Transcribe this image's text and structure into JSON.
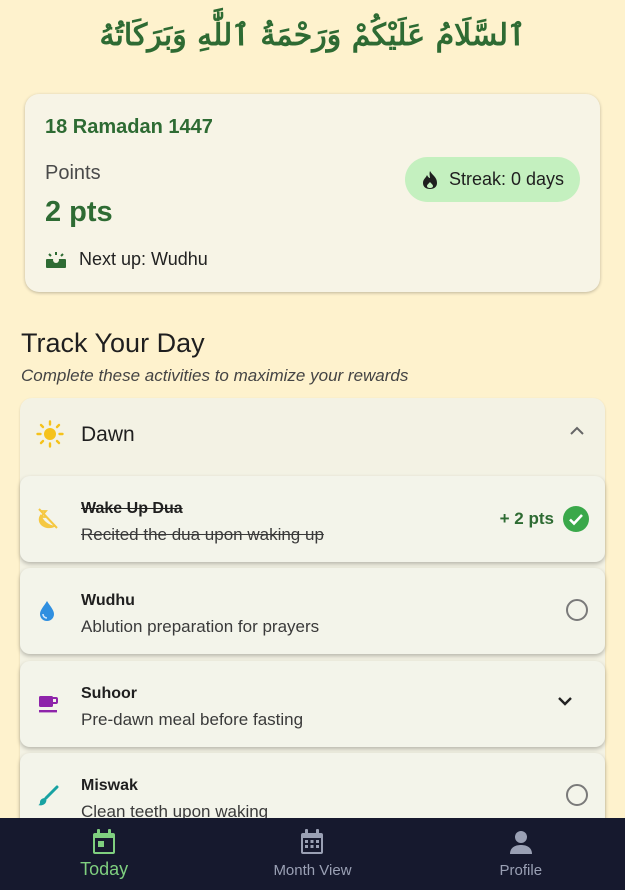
{
  "greeting": "ٱلسَّلَامُ عَلَيْكُمْ وَرَحْمَةُ ٱللَّٰهِ وَبَرَكَاتُهُ",
  "summary": {
    "hijri_date": "18 Ramadan 1447",
    "points_label": "Points",
    "points_value": "2 pts",
    "next_up": "Next up: Wudhu",
    "streak": "Streak: 0 days"
  },
  "section": {
    "title": "Track Your Day",
    "subtitle": "Complete these activities to maximize your rewards"
  },
  "dawn": {
    "title": "Dawn",
    "activities": [
      {
        "name": "Wake Up Dua",
        "desc": "Recited the dua upon waking up",
        "points": "+ 2 pts",
        "state": "completed",
        "icon": "sleep-moon-icon",
        "icon_color": "#f5c842"
      },
      {
        "name": "Wudhu",
        "desc": "Ablution preparation for prayers",
        "state": "unchecked",
        "icon": "water-drop-icon",
        "icon_color": "#2f8fe0"
      },
      {
        "name": "Suhoor",
        "desc": "Pre-dawn meal before fasting",
        "state": "expandable",
        "icon": "coffee-cup-icon",
        "icon_color": "#8e24aa"
      },
      {
        "name": "Miswak",
        "desc": "Clean teeth upon waking",
        "state": "unchecked",
        "icon": "brush-icon",
        "icon_color": "#17a2a2"
      }
    ]
  },
  "nav": {
    "items": [
      {
        "label": "Today",
        "icon": "calendar-today-icon",
        "active": true
      },
      {
        "label": "Month View",
        "icon": "calendar-month-icon",
        "active": false
      },
      {
        "label": "Profile",
        "icon": "person-icon",
        "active": false
      }
    ]
  },
  "colors": {
    "background": "#fef2cd",
    "primary_green": "#2e6b33",
    "streak_bg": "#c4f0bf",
    "nav_bg": "#16192e",
    "nav_active": "#7fcf7f",
    "check_green": "#3aa84a"
  }
}
